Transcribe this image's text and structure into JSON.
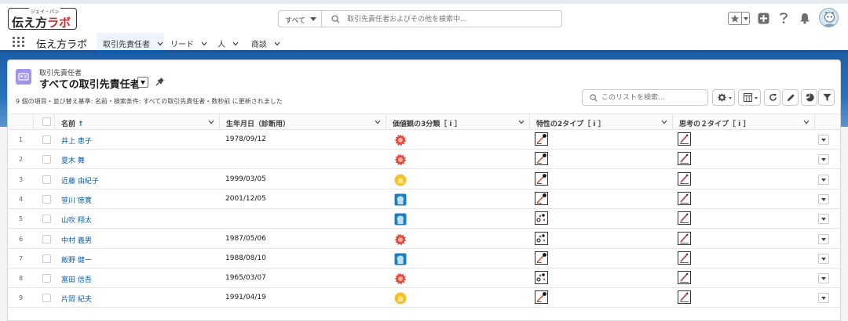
{
  "logo": {
    "ruby": "ジェイ・パン",
    "text_main": "伝え方",
    "text_accent": "ラボ"
  },
  "global_search": {
    "scope": "すべて",
    "placeholder": "取引先責任者およびその他を検索中..."
  },
  "app_nav": {
    "app_name": "伝え方ラボ",
    "tabs": [
      {
        "label": "取引先責任者",
        "active": true
      },
      {
        "label": "リード",
        "active": false
      },
      {
        "label": "人",
        "active": false
      },
      {
        "label": "商談",
        "active": false
      }
    ]
  },
  "list_view": {
    "object_label": "取引先責任者",
    "title": "すべての取引先責任者",
    "info": "9 個の項目・並び替え基準: 名前・検索条件: すべての取引先責任者・数秒前 に更新されました",
    "search_placeholder": "このリストを検索..."
  },
  "columns": {
    "name": "名前",
    "sort_indicator": "↑",
    "birthdate": "生年月日（診断用）",
    "values": "価値観の3分類［ i ］",
    "trait": "特性の2タイプ［ i ］",
    "thinking": "思考の２タイプ［ i ］"
  },
  "rows": [
    {
      "num": "1",
      "name": "井上 恵子",
      "birthdate": "1978/09/12",
      "values_icon": "red-burst-icon",
      "trait_icon": "slash-dot-icon",
      "thinking_icon": "pencil-icon"
    },
    {
      "num": "2",
      "name": "夏木 舞",
      "birthdate": "",
      "values_icon": "red-burst-icon",
      "trait_icon": "slash-dot-icon",
      "thinking_icon": "pencil-icon"
    },
    {
      "num": "3",
      "name": "近藤 由紀子",
      "birthdate": "1999/03/05",
      "values_icon": "yellow-bell-icon",
      "trait_icon": "slash-dot-icon",
      "thinking_icon": "pencil-icon"
    },
    {
      "num": "4",
      "name": "笹川 徳寛",
      "birthdate": "2001/12/05",
      "values_icon": "blue-head-icon",
      "trait_icon": "slash-dot-icon",
      "thinking_icon": "pencil-icon"
    },
    {
      "num": "5",
      "name": "山吹 翔太",
      "birthdate": "",
      "values_icon": "blue-head-icon",
      "trait_icon": "sparkle-icon",
      "thinking_icon": "pencil-icon"
    },
    {
      "num": "6",
      "name": "中村 義男",
      "birthdate": "1987/05/06",
      "values_icon": "red-burst-icon",
      "trait_icon": "sparkle-icon",
      "thinking_icon": "pencil-icon"
    },
    {
      "num": "7",
      "name": "飯野 健一",
      "birthdate": "1988/08/10",
      "values_icon": "blue-head-icon",
      "trait_icon": "slash-dot-icon",
      "thinking_icon": "pencil-icon"
    },
    {
      "num": "8",
      "name": "富田 信吾",
      "birthdate": "1965/03/07",
      "values_icon": "red-burst-icon",
      "trait_icon": "sparkle-icon",
      "thinking_icon": "pencil-icon"
    },
    {
      "num": "9",
      "name": "片岡 紀夫",
      "birthdate": "1991/04/19",
      "values_icon": "yellow-bell-icon",
      "trait_icon": "slash-dot-icon",
      "thinking_icon": "pencil-icon"
    }
  ],
  "colors": {
    "brand_blue": "#1b5297",
    "link": "#0b5cab",
    "object_icon": "#a094ed"
  }
}
